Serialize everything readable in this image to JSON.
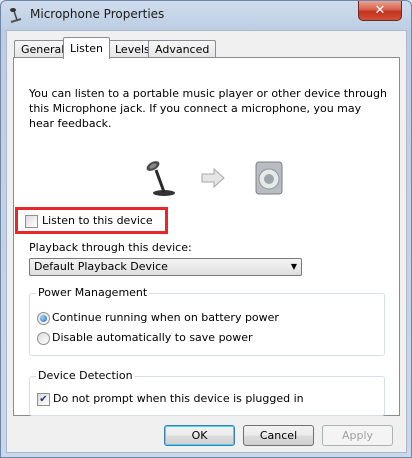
{
  "window": {
    "title": "Microphone Properties",
    "close_glyph": "✕"
  },
  "tabs": [
    {
      "label": "General"
    },
    {
      "label": "Listen"
    },
    {
      "label": "Levels"
    },
    {
      "label": "Advanced"
    }
  ],
  "listen": {
    "description": "You can listen to a portable music player or other device through this Microphone jack.  If you connect a microphone, you may hear feedback.",
    "listen_checkbox": {
      "label": "Listen to this device",
      "checked": false
    },
    "playback_label": "Playback through this device:",
    "playback_select": {
      "value": "Default Playback Device"
    },
    "power_group": {
      "title": "Power Management",
      "options": [
        {
          "label": "Continue running when on battery power",
          "selected": true
        },
        {
          "label": "Disable automatically to save power",
          "selected": false
        }
      ]
    },
    "detection_group": {
      "title": "Device Detection",
      "checkbox": {
        "label": "Do not prompt when this device is plugged in",
        "checked": true
      }
    }
  },
  "buttons": {
    "ok": "OK",
    "cancel": "Cancel",
    "apply": "Apply"
  },
  "colors": {
    "highlight": "#e8262c",
    "close": "#c2321e"
  }
}
